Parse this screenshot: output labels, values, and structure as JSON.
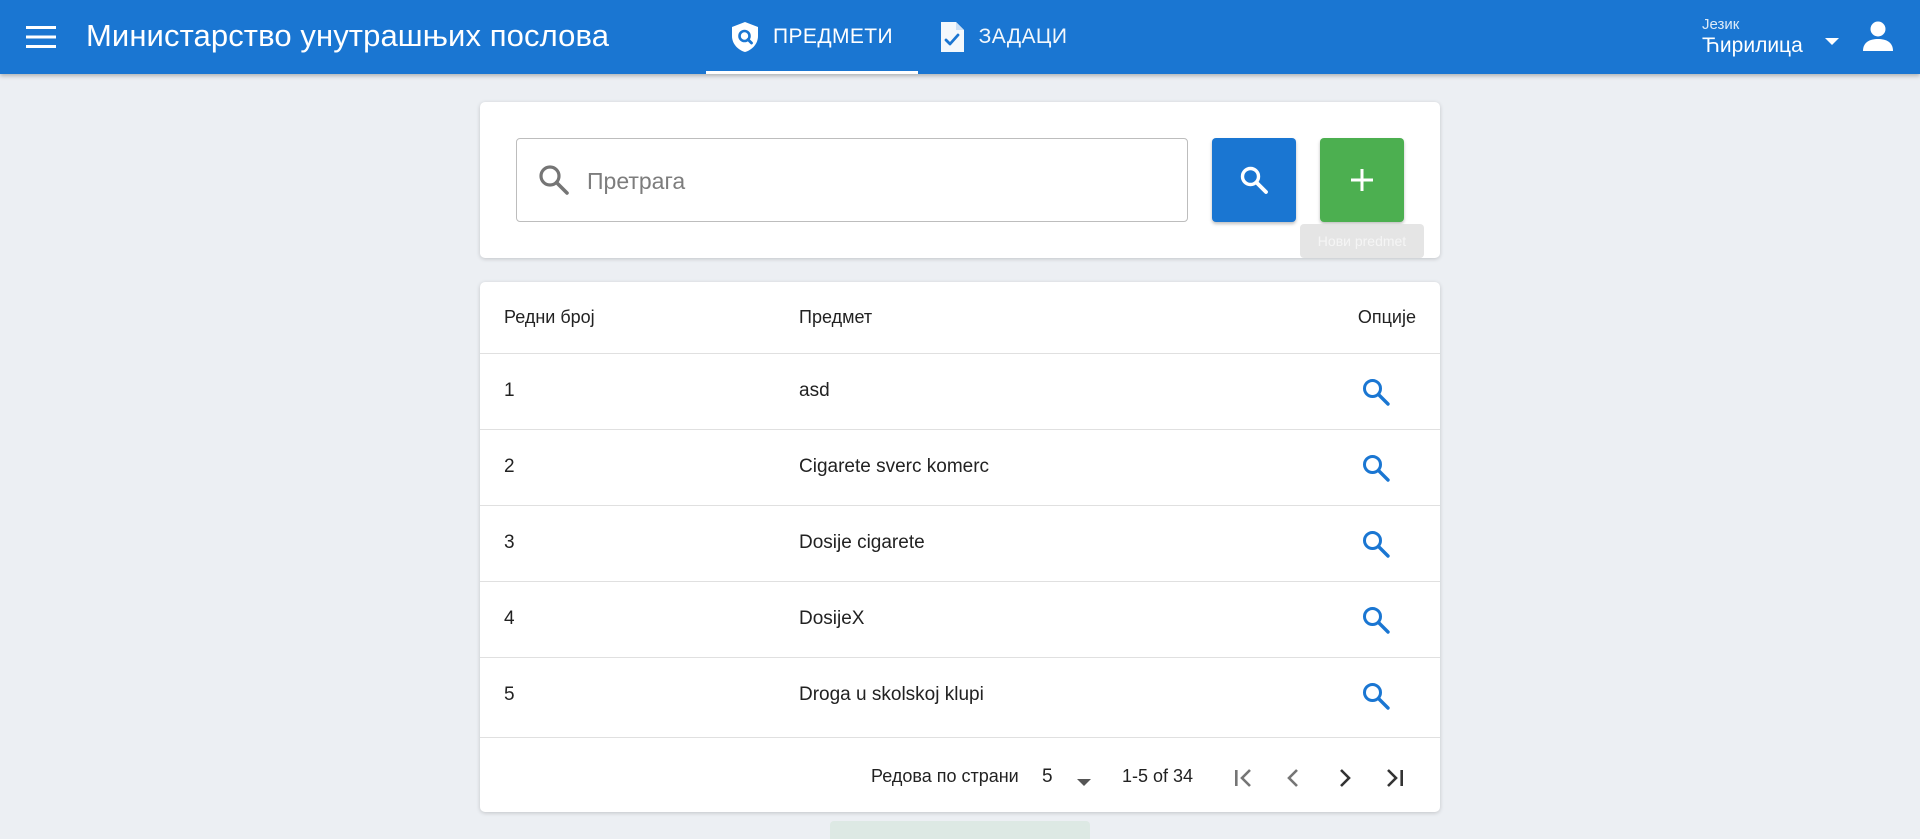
{
  "appbar": {
    "title": "Министарство унутрашњих послова",
    "tabs": [
      {
        "label": "ПРЕДМЕТИ",
        "icon": "shield-search-icon",
        "active": true
      },
      {
        "label": "ЗАДАЦИ",
        "icon": "task-file-icon",
        "active": false
      }
    ],
    "language": {
      "caption": "Језик",
      "value": "Ћирилица"
    }
  },
  "search": {
    "placeholder": "Претрага",
    "value": "",
    "add_tooltip": "Нови predmet"
  },
  "table": {
    "headers": {
      "number": "Редни број",
      "subject": "Предмет",
      "options": "Опције"
    },
    "rows": [
      {
        "number": "1",
        "subject": "asd"
      },
      {
        "number": "2",
        "subject": "Cigarete sverc komerc"
      },
      {
        "number": "3",
        "subject": "Dosije cigarete"
      },
      {
        "number": "4",
        "subject": "DosijeX"
      },
      {
        "number": "5",
        "subject": "Droga u skolskoj klupi"
      }
    ],
    "pagination": {
      "rows_per_page_label": "Редова по страни",
      "rows_per_page": "5",
      "range": "1-5 of 34"
    }
  },
  "colors": {
    "primary": "#1a76d2",
    "add": "#4caf50",
    "background": "#eceff3"
  }
}
